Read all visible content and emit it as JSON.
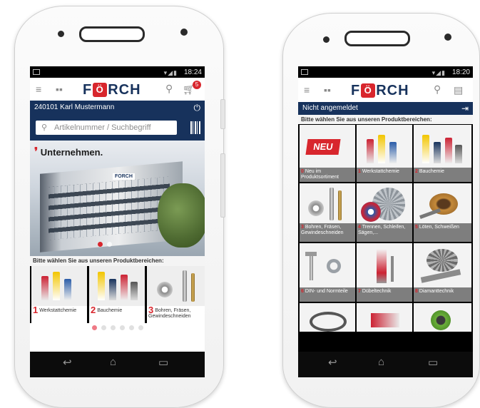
{
  "phone_left": {
    "status": {
      "time": "18:24"
    },
    "header": {
      "logo": "FORCH",
      "cart_badge": "5"
    },
    "account": {
      "user_label": "240101 Karl Mustermann"
    },
    "search": {
      "placeholder": "Artikelnummer / Suchbegriff"
    },
    "hero": {
      "slogan": "Unternehmen.",
      "sign": "FORCH",
      "slide_count": 2,
      "active_slide": 0
    },
    "section_label": "Bitte wählen Sie aus unseren Produktbereichen:",
    "categories": [
      {
        "num": "1",
        "label": "Werkstattchemie"
      },
      {
        "num": "2",
        "label": "Bauchemie"
      },
      {
        "num": "3",
        "label": "Bohren, Fräsen, Gewindeschneiden"
      }
    ],
    "pager": {
      "count": 6,
      "active": 0
    }
  },
  "phone_right": {
    "status": {
      "time": "18:20"
    },
    "header": {
      "logo": "FORCH"
    },
    "account": {
      "user_label": "Nicht angemeldet"
    },
    "section_label": "Bitte wählen Sie aus unseren Produktbereichen:",
    "new_badge": "NEU",
    "categories": [
      {
        "num": "0",
        "label": "Neu im Produktsortiment"
      },
      {
        "num": "1",
        "label": "Werkstattchemie"
      },
      {
        "num": "2",
        "label": "Bauchemie"
      },
      {
        "num": "3",
        "label": "Bohren, Fräsen, Gewindeschneiden"
      },
      {
        "num": "4",
        "label": "Trennen, Schleifen, Sägen,..."
      },
      {
        "num": "5",
        "label": "Löten, Schweißen"
      },
      {
        "num": "6",
        "label": "DIN- und Normteile"
      },
      {
        "num": "7",
        "label": "Dübeltechnik"
      },
      {
        "num": "8",
        "label": "Diamanttechnik"
      }
    ]
  },
  "colors": {
    "brand_blue": "#17325c",
    "brand_red": "#d8262d"
  },
  "icons": [
    "menu-icon",
    "grid-icon",
    "search-icon",
    "cart-icon",
    "power-icon",
    "login-icon",
    "barcode-icon",
    "list-icon",
    "back-icon",
    "home-icon",
    "recents-icon"
  ]
}
